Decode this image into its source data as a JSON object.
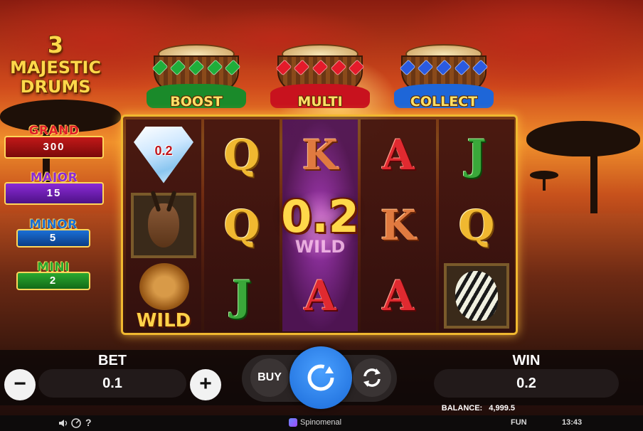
{
  "title": {
    "line1": "3",
    "line2": "MAJESTIC",
    "line3": "DRUMS"
  },
  "jackpots": {
    "grand": {
      "label": "GRAND",
      "value": "300"
    },
    "major": {
      "label": "MAJOR",
      "value": "15"
    },
    "minor": {
      "label": "MINOR",
      "value": "5"
    },
    "mini": {
      "label": "MINI",
      "value": "2"
    }
  },
  "drums": {
    "boost": {
      "label": "BOOST",
      "icon": "green-gem-drum-icon"
    },
    "multi": {
      "label": "MULTI",
      "icon": "red-gem-drum-icon"
    },
    "collect": {
      "label": "COLLECT",
      "icon": "blue-gem-drum-icon"
    }
  },
  "reels": {
    "reel1": {
      "top_value": "0.2",
      "bottom_label": "WILD",
      "symbols": [
        "diamond-icon",
        "antelope-icon",
        "lion-wild-icon"
      ]
    },
    "reel2": {
      "symbols": [
        "Q",
        "Q",
        "J"
      ]
    },
    "reel3": {
      "symbols": [
        "K",
        "lion-wild-icon",
        "A"
      ],
      "ghost_label": "WILD"
    },
    "reel4": {
      "symbols": [
        "A",
        "K",
        "A"
      ]
    },
    "reel5": {
      "symbols": [
        "J",
        "Q",
        "zebra-icon"
      ]
    },
    "win_overlay": "0.2"
  },
  "controls": {
    "bet": {
      "label": "BET",
      "value": "0.1",
      "minus": "−",
      "plus": "+"
    },
    "buy_label": "BUY",
    "spin_icon": "spin-arrows-icon",
    "autoplay_icon": "autoplay-arrows-icon",
    "win": {
      "label": "WIN",
      "value": "0.2"
    }
  },
  "status": {
    "balance_label": "BALANCE:",
    "balance_value": "4,999.5",
    "brand": "Spinomenal",
    "mode": "FUN",
    "time": "13:43",
    "icons": [
      "sound-icon",
      "turbo-icon",
      "help-icon"
    ],
    "help_glyph": "?"
  },
  "colors": {
    "accent": "#f0b830",
    "spin": "#2a7ae8",
    "grand": "#c21818",
    "major": "#8a2ad6",
    "minor": "#1a6fd6",
    "mini": "#2aa830"
  }
}
